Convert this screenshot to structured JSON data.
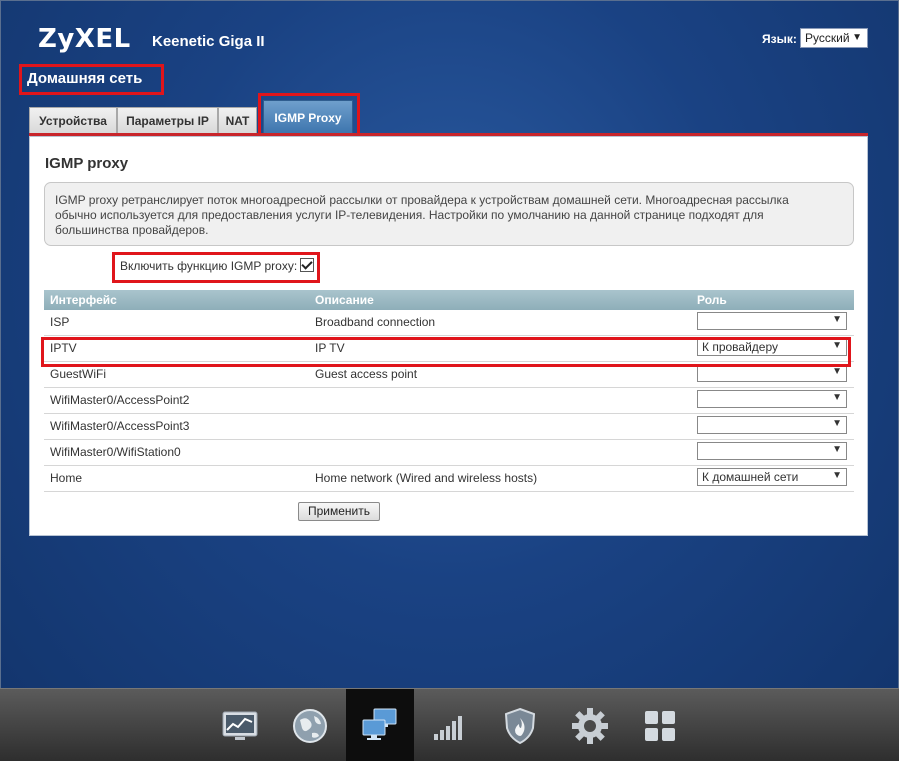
{
  "header": {
    "brand": "ZyXEL",
    "model": "Keenetic Giga II",
    "language_label": "Язык:",
    "language_value": "Русский"
  },
  "section_title": "Домашняя сеть",
  "tabs": [
    {
      "label": "Устройства",
      "active": false
    },
    {
      "label": "Параметры IP",
      "active": false
    },
    {
      "label": "NAT",
      "active": false
    },
    {
      "label": "IGMP Proxy",
      "active": true
    }
  ],
  "panel": {
    "title": "IGMP proxy",
    "info_lines": [
      "IGMP proxy ретранслирует поток многоадресной рассылки от провайдера к устройствам домашней сети. Многоадресная рассылка",
      "обычно используется для предоставления услуги IP-телевидения. Настройки по умолчанию на данной странице подходят для",
      "большинства провайдеров."
    ],
    "enable_label": "Включить функцию IGMP proxy:",
    "enable_checked": true,
    "columns": [
      "Интерфейс",
      "Описание",
      "Роль"
    ],
    "rows": [
      {
        "interface": "ISP",
        "description": "Broadband connection",
        "role": ""
      },
      {
        "interface": "IPTV",
        "description": "IP TV",
        "role": "К провайдеру"
      },
      {
        "interface": "GuestWiFi",
        "description": "Guest access point",
        "role": ""
      },
      {
        "interface": "WifiMaster0/AccessPoint2",
        "description": "",
        "role": ""
      },
      {
        "interface": "WifiMaster0/AccessPoint3",
        "description": "",
        "role": ""
      },
      {
        "interface": "WifiMaster0/WifiStation0",
        "description": "",
        "role": ""
      },
      {
        "interface": "Home",
        "description": "Home network (Wired and wireless hosts)",
        "role": "К домашней сети"
      }
    ],
    "apply_label": "Применить"
  },
  "bottom_nav": [
    {
      "icon": "monitor-chart-icon",
      "active": false
    },
    {
      "icon": "globe-icon",
      "active": false
    },
    {
      "icon": "network-computers-icon",
      "active": true
    },
    {
      "icon": "signal-bars-icon",
      "active": false
    },
    {
      "icon": "shield-flame-icon",
      "active": false
    },
    {
      "icon": "gear-icon",
      "active": false
    },
    {
      "icon": "grid-squares-icon",
      "active": false
    }
  ],
  "colors": {
    "highlight": "#e0151b",
    "active_tab": "#3c74ad",
    "background": "#1a4283"
  }
}
